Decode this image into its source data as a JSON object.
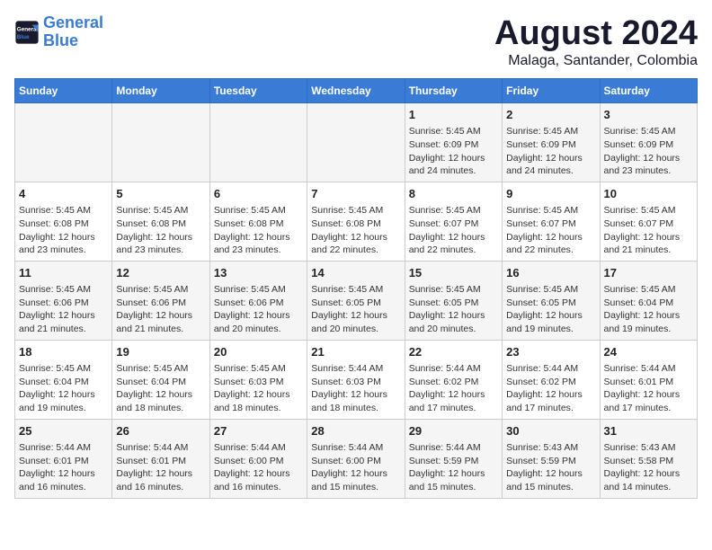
{
  "header": {
    "logo_line1": "General",
    "logo_line2": "Blue",
    "title": "August 2024",
    "subtitle": "Malaga, Santander, Colombia"
  },
  "weekdays": [
    "Sunday",
    "Monday",
    "Tuesday",
    "Wednesday",
    "Thursday",
    "Friday",
    "Saturday"
  ],
  "weeks": [
    [
      {
        "day": "",
        "info": ""
      },
      {
        "day": "",
        "info": ""
      },
      {
        "day": "",
        "info": ""
      },
      {
        "day": "",
        "info": ""
      },
      {
        "day": "1",
        "info": "Sunrise: 5:45 AM\nSunset: 6:09 PM\nDaylight: 12 hours\nand 24 minutes."
      },
      {
        "day": "2",
        "info": "Sunrise: 5:45 AM\nSunset: 6:09 PM\nDaylight: 12 hours\nand 24 minutes."
      },
      {
        "day": "3",
        "info": "Sunrise: 5:45 AM\nSunset: 6:09 PM\nDaylight: 12 hours\nand 23 minutes."
      }
    ],
    [
      {
        "day": "4",
        "info": "Sunrise: 5:45 AM\nSunset: 6:08 PM\nDaylight: 12 hours\nand 23 minutes."
      },
      {
        "day": "5",
        "info": "Sunrise: 5:45 AM\nSunset: 6:08 PM\nDaylight: 12 hours\nand 23 minutes."
      },
      {
        "day": "6",
        "info": "Sunrise: 5:45 AM\nSunset: 6:08 PM\nDaylight: 12 hours\nand 23 minutes."
      },
      {
        "day": "7",
        "info": "Sunrise: 5:45 AM\nSunset: 6:08 PM\nDaylight: 12 hours\nand 22 minutes."
      },
      {
        "day": "8",
        "info": "Sunrise: 5:45 AM\nSunset: 6:07 PM\nDaylight: 12 hours\nand 22 minutes."
      },
      {
        "day": "9",
        "info": "Sunrise: 5:45 AM\nSunset: 6:07 PM\nDaylight: 12 hours\nand 22 minutes."
      },
      {
        "day": "10",
        "info": "Sunrise: 5:45 AM\nSunset: 6:07 PM\nDaylight: 12 hours\nand 21 minutes."
      }
    ],
    [
      {
        "day": "11",
        "info": "Sunrise: 5:45 AM\nSunset: 6:06 PM\nDaylight: 12 hours\nand 21 minutes."
      },
      {
        "day": "12",
        "info": "Sunrise: 5:45 AM\nSunset: 6:06 PM\nDaylight: 12 hours\nand 21 minutes."
      },
      {
        "day": "13",
        "info": "Sunrise: 5:45 AM\nSunset: 6:06 PM\nDaylight: 12 hours\nand 20 minutes."
      },
      {
        "day": "14",
        "info": "Sunrise: 5:45 AM\nSunset: 6:05 PM\nDaylight: 12 hours\nand 20 minutes."
      },
      {
        "day": "15",
        "info": "Sunrise: 5:45 AM\nSunset: 6:05 PM\nDaylight: 12 hours\nand 20 minutes."
      },
      {
        "day": "16",
        "info": "Sunrise: 5:45 AM\nSunset: 6:05 PM\nDaylight: 12 hours\nand 19 minutes."
      },
      {
        "day": "17",
        "info": "Sunrise: 5:45 AM\nSunset: 6:04 PM\nDaylight: 12 hours\nand 19 minutes."
      }
    ],
    [
      {
        "day": "18",
        "info": "Sunrise: 5:45 AM\nSunset: 6:04 PM\nDaylight: 12 hours\nand 19 minutes."
      },
      {
        "day": "19",
        "info": "Sunrise: 5:45 AM\nSunset: 6:04 PM\nDaylight: 12 hours\nand 18 minutes."
      },
      {
        "day": "20",
        "info": "Sunrise: 5:45 AM\nSunset: 6:03 PM\nDaylight: 12 hours\nand 18 minutes."
      },
      {
        "day": "21",
        "info": "Sunrise: 5:44 AM\nSunset: 6:03 PM\nDaylight: 12 hours\nand 18 minutes."
      },
      {
        "day": "22",
        "info": "Sunrise: 5:44 AM\nSunset: 6:02 PM\nDaylight: 12 hours\nand 17 minutes."
      },
      {
        "day": "23",
        "info": "Sunrise: 5:44 AM\nSunset: 6:02 PM\nDaylight: 12 hours\nand 17 minutes."
      },
      {
        "day": "24",
        "info": "Sunrise: 5:44 AM\nSunset: 6:01 PM\nDaylight: 12 hours\nand 17 minutes."
      }
    ],
    [
      {
        "day": "25",
        "info": "Sunrise: 5:44 AM\nSunset: 6:01 PM\nDaylight: 12 hours\nand 16 minutes."
      },
      {
        "day": "26",
        "info": "Sunrise: 5:44 AM\nSunset: 6:01 PM\nDaylight: 12 hours\nand 16 minutes."
      },
      {
        "day": "27",
        "info": "Sunrise: 5:44 AM\nSunset: 6:00 PM\nDaylight: 12 hours\nand 16 minutes."
      },
      {
        "day": "28",
        "info": "Sunrise: 5:44 AM\nSunset: 6:00 PM\nDaylight: 12 hours\nand 15 minutes."
      },
      {
        "day": "29",
        "info": "Sunrise: 5:44 AM\nSunset: 5:59 PM\nDaylight: 12 hours\nand 15 minutes."
      },
      {
        "day": "30",
        "info": "Sunrise: 5:43 AM\nSunset: 5:59 PM\nDaylight: 12 hours\nand 15 minutes."
      },
      {
        "day": "31",
        "info": "Sunrise: 5:43 AM\nSunset: 5:58 PM\nDaylight: 12 hours\nand 14 minutes."
      }
    ]
  ]
}
